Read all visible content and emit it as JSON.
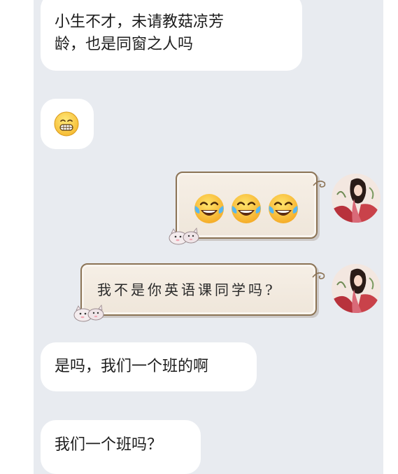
{
  "chat": {
    "messages": [
      {
        "from": "other",
        "text": "小生不才，未请教菇凉芳\n龄，也是同窗之人吗"
      },
      {
        "from": "other",
        "emoji": "grin-emoji"
      },
      {
        "from": "self",
        "emoji": [
          "tears-of-joy-emoji",
          "tears-of-joy-emoji",
          "tears-of-joy-emoji"
        ]
      },
      {
        "from": "self",
        "text": "我不是你英语课同学吗?"
      },
      {
        "from": "other",
        "text": "是吗，我们一个班的啊"
      },
      {
        "from": "other",
        "text": "我们一个班吗？"
      }
    ]
  },
  "colors": {
    "background": "#e8ebf0",
    "bubble_other": "#ffffff",
    "bubble_self_border": "#8b7355",
    "bubble_self_fill": "#f6efe6"
  }
}
